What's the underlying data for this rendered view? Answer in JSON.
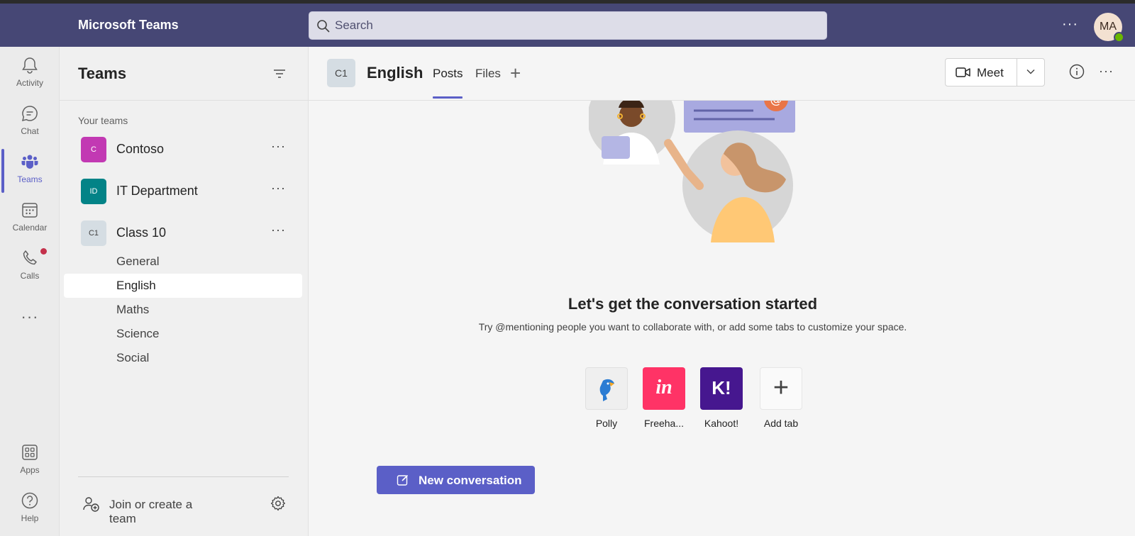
{
  "app": {
    "title": "Microsoft Teams"
  },
  "search": {
    "placeholder": "Search"
  },
  "user": {
    "initials": "MA",
    "presence": "available"
  },
  "rail": {
    "items": [
      {
        "label": "Activity",
        "icon": "bell-icon"
      },
      {
        "label": "Chat",
        "icon": "chat-icon"
      },
      {
        "label": "Teams",
        "icon": "teams-icon",
        "active": true
      },
      {
        "label": "Calendar",
        "icon": "calendar-icon"
      },
      {
        "label": "Calls",
        "icon": "phone-icon",
        "badge": true
      },
      {
        "label": "Apps",
        "icon": "apps-icon"
      },
      {
        "label": "Help",
        "icon": "help-icon"
      }
    ],
    "more": "···"
  },
  "panel": {
    "title": "Teams",
    "section_label": "Your teams",
    "teams": [
      {
        "initials": "C",
        "name": "Contoso",
        "color": "#c239b3"
      },
      {
        "initials": "ID",
        "name": "IT Department",
        "color": "#038387"
      },
      {
        "initials": "C1",
        "name": "Class 10",
        "color": "#d5dde3"
      }
    ],
    "channels": [
      "General",
      "English",
      "Maths",
      "Science",
      "Social"
    ],
    "selected_channel": "English",
    "more": "···",
    "join_label": "Join or create a team"
  },
  "channel_header": {
    "avatar": "C1",
    "title": "English",
    "tabs": [
      "Posts",
      "Files"
    ],
    "active_tab": "Posts",
    "add_tab_glyph": "+",
    "meet_label": "Meet",
    "more": "···"
  },
  "main": {
    "headline": "Let's get the conversation started",
    "subline": "Try @mentioning people you want to collaborate with, or add some tabs to customize your space.",
    "apps": [
      {
        "label": "Polly",
        "icon": "polly-icon"
      },
      {
        "label": "Freeha...",
        "icon": "invision-freehand-icon",
        "color": "#ff3366",
        "glyph": "in"
      },
      {
        "label": "Kahoot!",
        "icon": "kahoot-icon",
        "color": "#46178f",
        "glyph": "K!"
      },
      {
        "label": "Add tab",
        "icon": "plus-icon",
        "glyph": "+"
      }
    ],
    "new_conversation_label": "New conversation"
  },
  "colors": {
    "brand": "#464775",
    "accent": "#5b5fc7"
  }
}
